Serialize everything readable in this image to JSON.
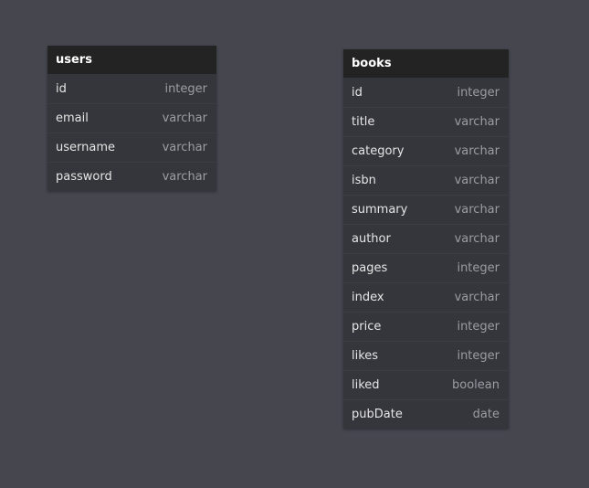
{
  "tables": {
    "users": {
      "name": "users",
      "fields": [
        {
          "name": "id",
          "type": "integer"
        },
        {
          "name": "email",
          "type": "varchar"
        },
        {
          "name": "username",
          "type": "varchar"
        },
        {
          "name": "password",
          "type": "varchar"
        }
      ]
    },
    "books": {
      "name": "books",
      "fields": [
        {
          "name": "id",
          "type": "integer"
        },
        {
          "name": "title",
          "type": "varchar"
        },
        {
          "name": "category",
          "type": "varchar"
        },
        {
          "name": "isbn",
          "type": "varchar"
        },
        {
          "name": "summary",
          "type": "varchar"
        },
        {
          "name": "author",
          "type": "varchar"
        },
        {
          "name": "pages",
          "type": "integer"
        },
        {
          "name": "index",
          "type": "varchar"
        },
        {
          "name": "price",
          "type": "integer"
        },
        {
          "name": "likes",
          "type": "integer"
        },
        {
          "name": "liked",
          "type": "boolean"
        },
        {
          "name": "pubDate",
          "type": "date"
        }
      ]
    }
  }
}
